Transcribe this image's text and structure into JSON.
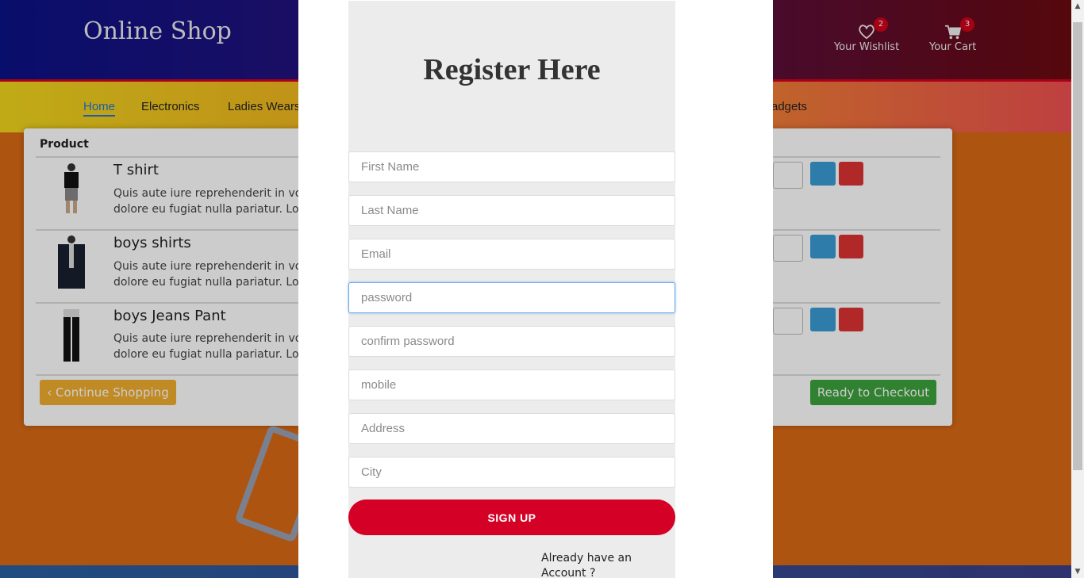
{
  "header": {
    "brand": "Online Shop",
    "wishlist": {
      "label": "Your Wishlist",
      "count": "2",
      "icon": "heart-icon"
    },
    "cart": {
      "label": "Your Cart",
      "count": "3",
      "icon": "cart-icon"
    }
  },
  "nav": {
    "items": [
      "Home",
      "Electronics",
      "Ladies Wears",
      "adgets"
    ],
    "active": "Home"
  },
  "cart": {
    "column_header": "Product",
    "rows": [
      {
        "title": "T shirt",
        "desc_line1": "Quis aute iure reprehenderit in vo",
        "desc_line2": "dolore eu fugiat nulla pariatur. Lo"
      },
      {
        "title": "boys shirts",
        "desc_line1": "Quis aute iure reprehenderit in vo",
        "desc_line2": "dolore eu fugiat nulla pariatur. Lo"
      },
      {
        "title": "boys Jeans Pant",
        "desc_line1": "Quis aute iure reprehenderit in vo",
        "desc_line2": "dolore eu fugiat nulla pariatur. Lo"
      }
    ],
    "continue_label": "‹ Continue Shopping",
    "checkout_label": "Ready to Checkout"
  },
  "modal": {
    "title": "Register Here",
    "fields": [
      {
        "placeholder": "First Name",
        "value": ""
      },
      {
        "placeholder": "Last Name",
        "value": ""
      },
      {
        "placeholder": "Email",
        "value": ""
      },
      {
        "placeholder": "password",
        "value": ""
      },
      {
        "placeholder": "confirm password",
        "value": ""
      },
      {
        "placeholder": "mobile",
        "value": ""
      },
      {
        "placeholder": "Address",
        "value": ""
      },
      {
        "placeholder": "City",
        "value": ""
      }
    ],
    "signup_label": "SIGN UP",
    "login_prompt": "Already have an Account ?"
  },
  "colors": {
    "accent": "#d40026",
    "link": "#2274d6"
  }
}
